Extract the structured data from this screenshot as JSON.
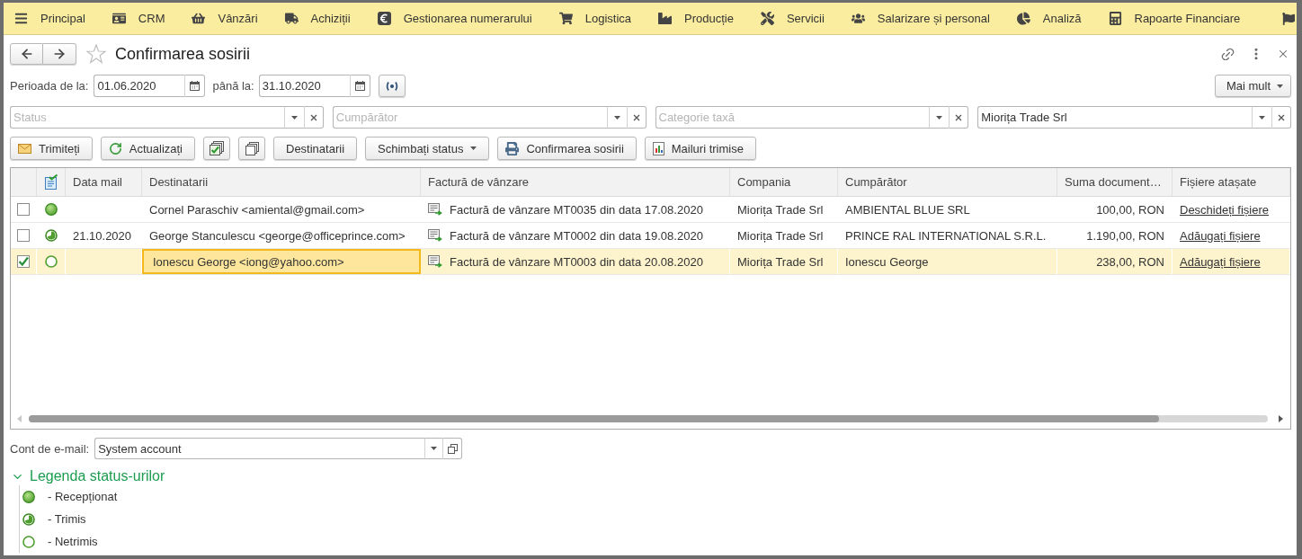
{
  "menu_bar": {
    "items": [
      "Principal",
      "CRM",
      "Vânzări",
      "Achiziții",
      "Gestionarea numerarului",
      "Logistica",
      "Producție",
      "Servicii",
      "Salarizare și personal",
      "Analiză",
      "Rapoarte Financiare"
    ]
  },
  "form": {
    "title": "Confirmarea sosirii",
    "favorite": false
  },
  "period": {
    "from_label": "Perioada de la:",
    "from": "01.06.2020",
    "to_label": "până la:",
    "to": "31.10.2020"
  },
  "more_button": {
    "label": "Mai mult"
  },
  "filters": [
    {
      "placeholder": "Status"
    },
    {
      "placeholder": "Cumpărător"
    },
    {
      "placeholder": "Categorie taxă"
    },
    {
      "value": "Miorița Trade Srl"
    }
  ],
  "toolbar": [
    {
      "kind": "button",
      "label": "Trimiteți"
    },
    {
      "kind": "button",
      "label": "Actualizați"
    },
    {
      "kind": "icon"
    },
    {
      "kind": "icon"
    },
    {
      "kind": "button",
      "label": "Destinatarii"
    },
    {
      "kind": "dropdown",
      "label": "Schimbați status"
    },
    {
      "kind": "button",
      "label": "Confirmarea sosirii"
    },
    {
      "kind": "button",
      "label": "Mailuri trimise"
    }
  ],
  "table": {
    "columns": [
      "Data mail",
      "Destinatarii",
      "Factură de vânzare",
      "Compania",
      "Cumpărător",
      "Suma document…",
      "Fișiere atașate"
    ],
    "rows": [
      {
        "selected": false,
        "checked": false,
        "kind": "received",
        "recipient": "Cornel Paraschiv <amiental@gmail.com>",
        "invoice": "Factură de vânzare MT0035 din data 17.08.2020",
        "company": "Miorița Trade Srl",
        "buyer": "AMBIENTAL BLUE SRL",
        "amount": "100,00, RON",
        "files": "Deschideți fișiere"
      },
      {
        "selected": false,
        "checked": false,
        "kind": "sent",
        "data_mail": "21.10.2020",
        "recipient": "George Stanculescu <george@officeprince.com>",
        "invoice": "Factură de vânzare MT0002 din data 19.08.2020",
        "company": "Miorița Trade Srl",
        "buyer": "PRINCE RAL INTERNATIONAL S.R.L.",
        "amount": "1.190,00, RON",
        "files": "Adăugați fișiere"
      },
      {
        "selected": true,
        "checked": true,
        "kind": "unsent",
        "recipient": "Ionescu George <iong@yahoo.com>",
        "invoice": "Factură de vânzare MT0003 din data 20.08.2020",
        "company": "Miorița Trade Srl",
        "buyer": "Ionescu George",
        "amount": "238,00, RON",
        "files": "Adăugați fișiere"
      }
    ]
  },
  "email_account": {
    "label": "Cont de e-mail:",
    "value": "System account"
  },
  "legend": {
    "title": "Legenda status-urilor",
    "expanded": true,
    "items": [
      {
        "kind": "received",
        "label": "- Recepționat"
      },
      {
        "kind": "sent",
        "label": "- Trimis"
      },
      {
        "kind": "unsent",
        "label": "- Netrimis"
      }
    ]
  }
}
